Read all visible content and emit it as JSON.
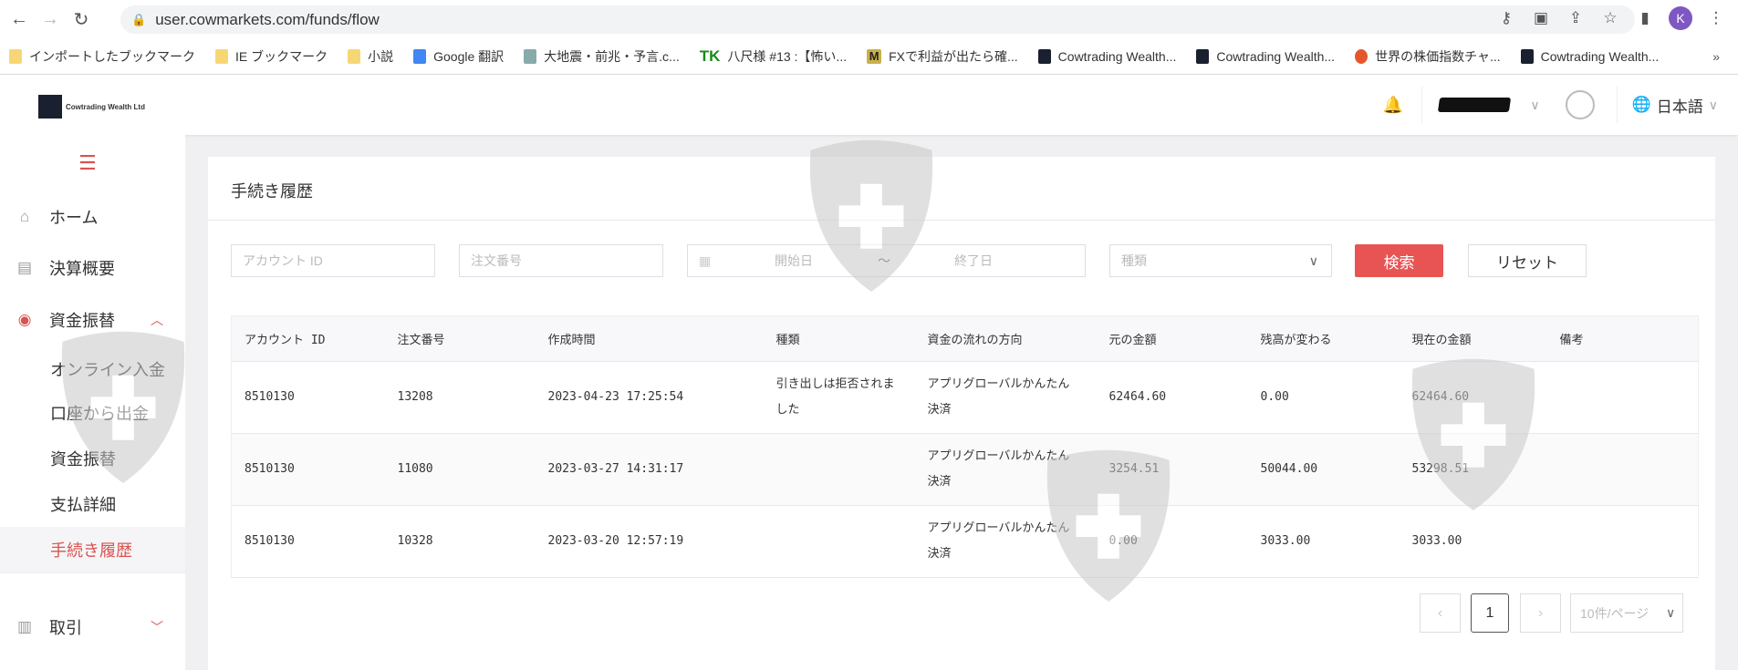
{
  "browser": {
    "url": "user.cowmarkets.com/funds/flow",
    "profile_initial": "K",
    "bookmarks": [
      "インポートしたブックマーク",
      "IE ブックマーク",
      "小説",
      "Google 翻訳",
      "大地震・前兆・予言.c...",
      "八尺様 #13 :【怖い...",
      "FXで利益が出たら確...",
      "Cowtrading Wealth...",
      "Cowtrading Wealth...",
      "世界の株価指数チャ...",
      "Cowtrading Wealth..."
    ],
    "bookmark_tk": "TK",
    "bookmark_m": "M",
    "more": "»"
  },
  "header": {
    "logo_text": "Cowtrading Wealth Ltd",
    "language": "日本語"
  },
  "sidebar": {
    "items": [
      {
        "label": "ホーム"
      },
      {
        "label": "決算概要"
      },
      {
        "label": "資金振替"
      },
      {
        "label": "オンライン入金"
      },
      {
        "label": "口座から出金"
      },
      {
        "label": "資金振替"
      },
      {
        "label": "支払詳細"
      },
      {
        "label": "手続き履歴"
      },
      {
        "label": "取引"
      }
    ]
  },
  "page": {
    "title": "手続き履歴"
  },
  "filters": {
    "account_placeholder": "アカウント ID",
    "order_placeholder": "注文番号",
    "start_placeholder": "開始日",
    "range_sep": "～",
    "end_placeholder": "終了日",
    "type_placeholder": "種類",
    "search_label": "検索",
    "reset_label": "リセット"
  },
  "table": {
    "headers": [
      "アカウント ID",
      "注文番号",
      "作成時間",
      "種類",
      "資金の流れの方向",
      "元の金額",
      "残高が変わる",
      "現在の金額",
      "備考"
    ],
    "rows": [
      [
        "8510130",
        "13208",
        "2023-04-23 17:25:54",
        "引き出しは拒否されました",
        "アプリグローバルかんたん決済",
        "62464.60",
        "0.00",
        "62464.60",
        ""
      ],
      [
        "8510130",
        "11080",
        "2023-03-27 14:31:17",
        "",
        "アプリグローバルかんたん決済",
        "3254.51",
        "50044.00",
        "53298.51",
        ""
      ],
      [
        "8510130",
        "10328",
        "2023-03-20 12:57:19",
        "",
        "アプリグローバルかんたん決済",
        "0.00",
        "3033.00",
        "3033.00",
        ""
      ]
    ]
  },
  "pagination": {
    "current": "1",
    "page_size": "10件/ページ",
    "prev": "‹",
    "next": "›"
  },
  "colors": {
    "accent": "#e85454",
    "active_text": "#d9534f"
  }
}
